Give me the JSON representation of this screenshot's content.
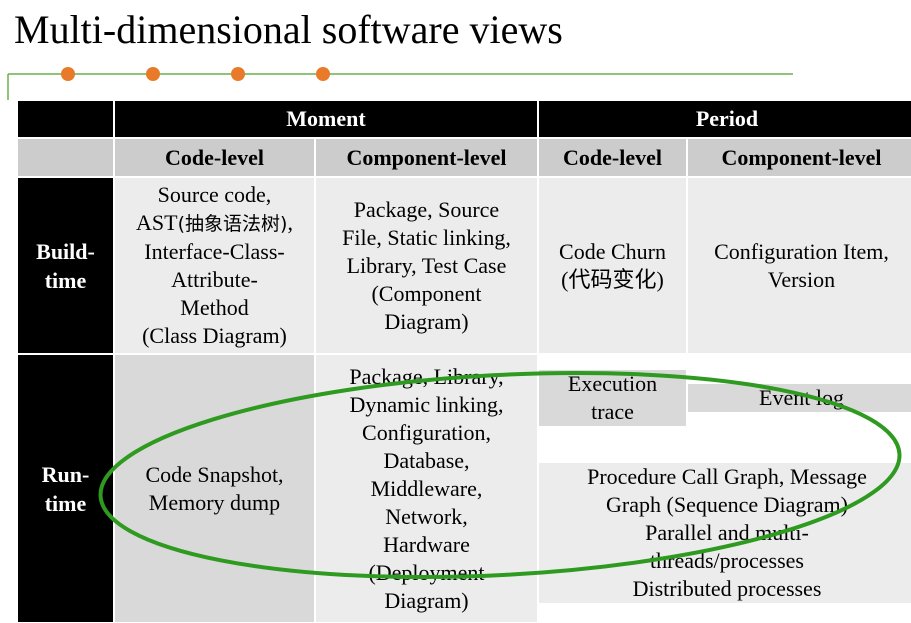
{
  "title": "Multi-dimensional software views",
  "header": {
    "moment": "Moment",
    "period": "Period",
    "moment_code": "Code-level",
    "moment_component": "Component-level",
    "period_code": "Code-level",
    "period_component": "Component-level"
  },
  "rows": {
    "build_label": "Build-\ntime",
    "run_label": "Run-\ntime"
  },
  "build": {
    "moment_code_pre": "Source code,\nAST",
    "moment_code_cjk": "(抽象语法树)",
    "moment_code_post": ",\nInterface-Class-\nAttribute-\nMethod\n(Class Diagram)",
    "moment_component": "Package, Source\nFile, Static linking,\nLibrary, Test Case\n(Component\nDiagram)",
    "period_code": "Code Churn\n(代码变化)",
    "period_component": "Configuration Item,\nVersion"
  },
  "run": {
    "moment_code": "Code Snapshot,\nMemory dump",
    "moment_component": "Package, Library,\nDynamic  linking,\nConfiguration,\nDatabase,\nMiddleware,\nNetwork,\nHardware\n(Deployment\nDiagram)",
    "period_code": "Execution\ntrace",
    "period_component": "Event log",
    "period_callgraph": "Procedure Call Graph, Message\nGraph (Sequence Diagram)",
    "period_parallel": "Parallel and multi-\nthreads/processes\nDistributed processes"
  },
  "colors": {
    "accent_line": "#6ab04c",
    "bullet": "#e87a2a",
    "ellipse": "#2e9a1f"
  }
}
